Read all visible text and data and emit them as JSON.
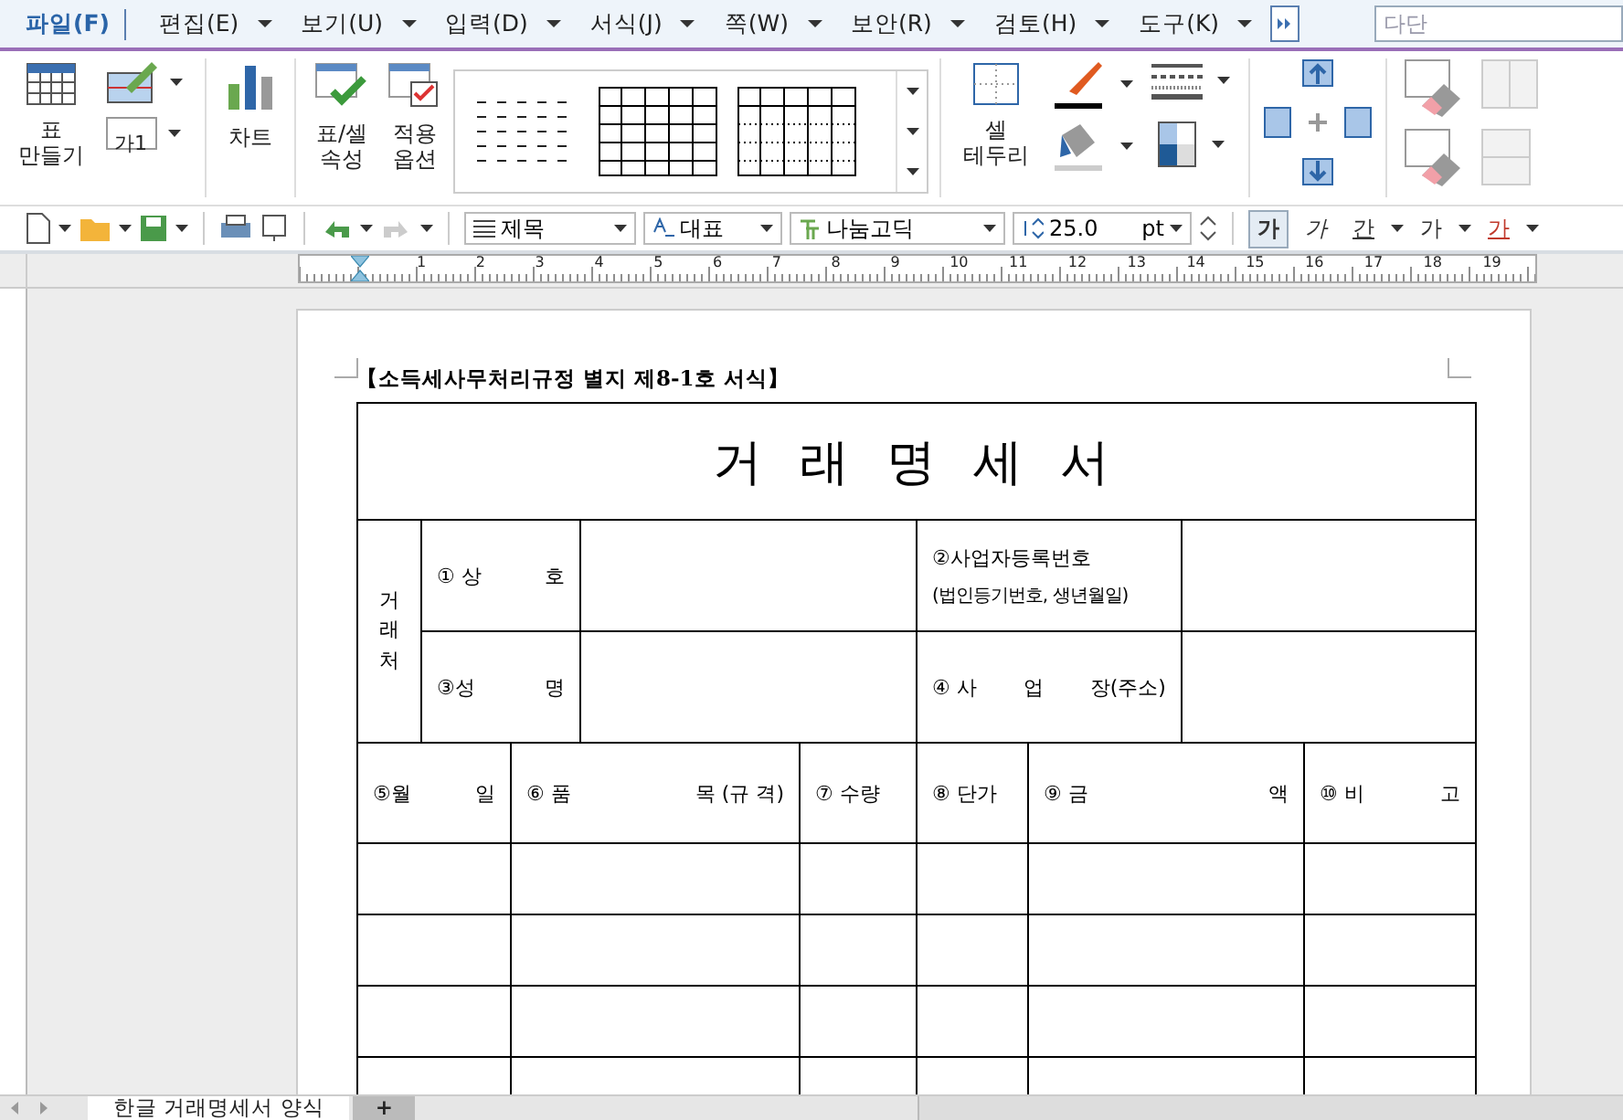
{
  "menu": [
    {
      "label": "파일(F)",
      "selected": true,
      "dropdown": false
    },
    {
      "label": "편집(E)",
      "selected": false,
      "dropdown": true
    },
    {
      "label": "보기(U)",
      "selected": false,
      "dropdown": true
    },
    {
      "label": "입력(D)",
      "selected": false,
      "dropdown": true
    },
    {
      "label": "서식(J)",
      "selected": false,
      "dropdown": true
    },
    {
      "label": "쪽(W)",
      "selected": false,
      "dropdown": true
    },
    {
      "label": "보안(R)",
      "selected": false,
      "dropdown": true
    },
    {
      "label": "검토(H)",
      "selected": false,
      "dropdown": true
    },
    {
      "label": "도구(K)",
      "selected": false,
      "dropdown": true
    }
  ],
  "search": {
    "placeholder": "다단"
  },
  "ribbon": {
    "make_table": [
      "표",
      "만들기"
    ],
    "cell_style": "가1",
    "chart": "차트",
    "table_props": [
      "표/셀",
      "속성"
    ],
    "apply_options": [
      "적용",
      "옵션"
    ],
    "cell_border": [
      "셀",
      "테두리"
    ]
  },
  "toolbar": {
    "style": "제목",
    "lang": "대표",
    "font": "나눔고딕",
    "size": "25.0",
    "unit": "pt",
    "bold": "가",
    "italic": "가",
    "underline": "간",
    "strike": "가",
    "font_color_label": "가"
  },
  "ruler": [
    "1",
    "2",
    "3",
    "4",
    "5",
    "6",
    "7",
    "8",
    "9",
    "10",
    "11",
    "12",
    "13",
    "14",
    "15",
    "16",
    "17",
    "18",
    "19"
  ],
  "document": {
    "caption": "【소득세사무처리규정 별지 제8-1호 서식】",
    "title": "거 래 명 세 서",
    "party_label": "거래처",
    "field_rows": [
      {
        "left": [
          "① 상",
          "호"
        ],
        "right": [
          "②사업자등록번호",
          "(법인등기번호, 생년월일)"
        ]
      },
      {
        "left": [
          "③성",
          "명"
        ],
        "right": [
          "④ 사",
          "업",
          "장(주소)"
        ]
      }
    ],
    "columns": [
      {
        "parts": [
          "⑤월",
          "일"
        ]
      },
      {
        "parts": [
          "⑥ 품",
          "목 (규 격)"
        ]
      },
      {
        "parts": [
          "⑦ 수량"
        ]
      },
      {
        "parts": [
          "⑧ 단가"
        ]
      },
      {
        "parts": [
          "⑨ 금",
          "액"
        ]
      },
      {
        "parts": [
          "⑩ 비",
          "고"
        ]
      }
    ]
  },
  "tabs": [
    {
      "label": "한글 거래명세서 양식",
      "selected": true
    },
    {
      "label": "+",
      "selected": false
    }
  ]
}
